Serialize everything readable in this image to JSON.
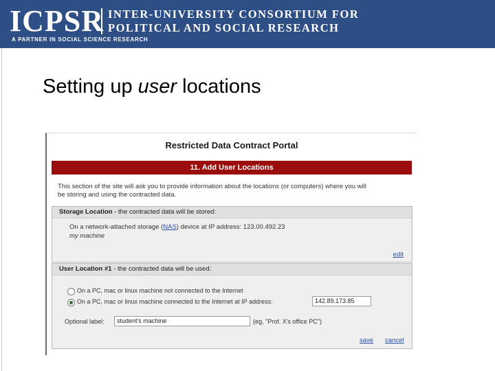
{
  "header": {
    "logo": "ICPSR",
    "org_line1": "INTER-UNIVERSITY CONSORTIUM FOR",
    "org_line2": "POLITICAL AND SOCIAL RESEARCH",
    "tagline": "A PARTNER IN SOCIAL SCIENCE RESEARCH"
  },
  "slide": {
    "title_pre": "Setting up ",
    "title_em": "user",
    "title_post": " locations"
  },
  "portal": {
    "title": "Restricted Data Contract Portal",
    "step_title": "11. Add User Locations",
    "intro_line1": "This section of the site will ask you to provide information about the locations (or computers) where you will",
    "intro_line2": "be storing and using the contracted data.",
    "storage": {
      "head_bold": "Storage Location",
      "head_rest": " - the contracted data will be stored:",
      "desc_pre": "On a network-attached storage (",
      "nas_link": "NAS",
      "desc_post": ") device at IP address: 123.00.492.23",
      "name": "my machine",
      "edit_link": "edit"
    },
    "user_location": {
      "head_bold": "User Location #1",
      "head_rest": " - the contracted data will be used:",
      "option1": "On a PC, mac or linux machine not connected to the Internet",
      "option2": "On a PC, mac or linux machine connected to the Internet at IP address:",
      "selected_option": "option2",
      "ip_value": "142.89.173.85",
      "label_caption": "Optional label:",
      "label_value": "student's machine",
      "label_hint": "(eg, \"Prof. X's office PC\")",
      "save_link": "save",
      "cancel_link": "cancel"
    }
  }
}
